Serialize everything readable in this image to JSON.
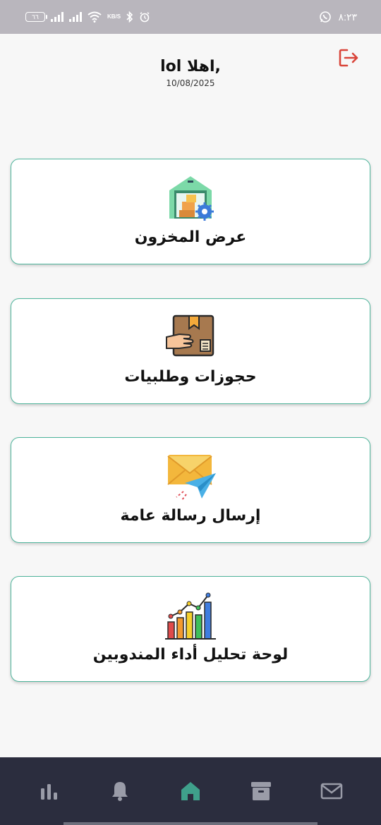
{
  "status_bar": {
    "battery": "٦٦",
    "speed_unit": "KB/S",
    "time": "٨:٢٣"
  },
  "header": {
    "greeting": "lol اهلا,",
    "date": "10/08/2025"
  },
  "menu": [
    {
      "label": "عرض المخزون",
      "icon": "warehouse-icon"
    },
    {
      "label": "حجوزات وطلبيات",
      "icon": "package-hand-icon"
    },
    {
      "label": "إرسال رسالة عامة",
      "icon": "mail-send-icon"
    },
    {
      "label": "لوحة تحليل أداء المندوبين",
      "icon": "bar-chart-icon"
    }
  ],
  "bottom_nav": [
    {
      "name": "stats",
      "icon": "bar-chart-small-icon",
      "active": false
    },
    {
      "name": "notifications",
      "icon": "bell-icon",
      "active": false
    },
    {
      "name": "home",
      "icon": "home-icon",
      "active": true
    },
    {
      "name": "archive",
      "icon": "archive-icon",
      "active": false
    },
    {
      "name": "mail",
      "icon": "mail-icon",
      "active": false
    }
  ],
  "colors": {
    "accent": "#4fb59c",
    "logout": "#d9453a",
    "nav_bg": "#2b2d3e",
    "nav_active": "#3fa08b",
    "nav_inactive": "#9a9ca8"
  }
}
